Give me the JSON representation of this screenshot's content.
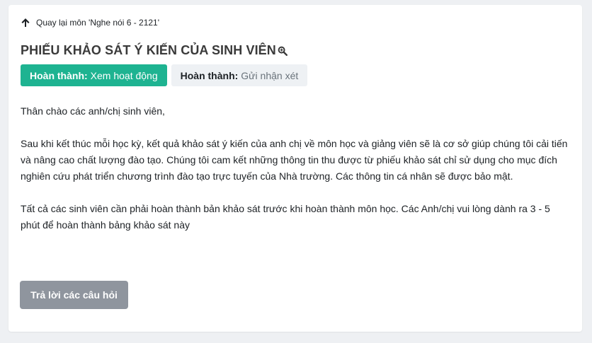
{
  "back": {
    "label": "Quay lại môn 'Nghe nói 6 - 2121'",
    "icon": "arrow-up-icon"
  },
  "title": {
    "text": "PHIẾU KHẢO SÁT Ý KIẾN CỦA SINH VIÊN",
    "icon": "zoom-icon"
  },
  "completion": [
    {
      "label": "Hoàn thành:",
      "value": "Xem hoạt động",
      "state": "done",
      "color": "#1eb391"
    },
    {
      "label": "Hoàn thành:",
      "value": "Gửi nhận xét",
      "state": "pending",
      "color": "#eef1f4"
    }
  ],
  "intro": {
    "greeting": "Thân chào các anh/chị sinh viên,",
    "paragraph1": "Sau khi kết thúc mỗi học kỳ, kết quả khảo sát ý kiến của anh chị về môn học và giảng viên sẽ là cơ sở giúp chúng tôi cải tiến và nâng cao chất lượng đào tạo. Chúng tôi cam kết những thông tin thu được từ phiếu khảo sát chỉ sử dụng cho mục đích nghiên cứu phát triển chương trình đào tạo trực tuyến của Nhà trường. Các thông tin cá nhân sẽ được bảo mật.",
    "paragraph2": "Tất cả các sinh viên cần phải hoàn thành bản khảo sát trước khi hoàn thành môn học. Các Anh/chị vui lòng dành ra 3 - 5 phút để hoàn thành bảng khảo sát này"
  },
  "answer_button": {
    "label": "Trả lời các câu hỏi",
    "color": "#8f959e"
  }
}
